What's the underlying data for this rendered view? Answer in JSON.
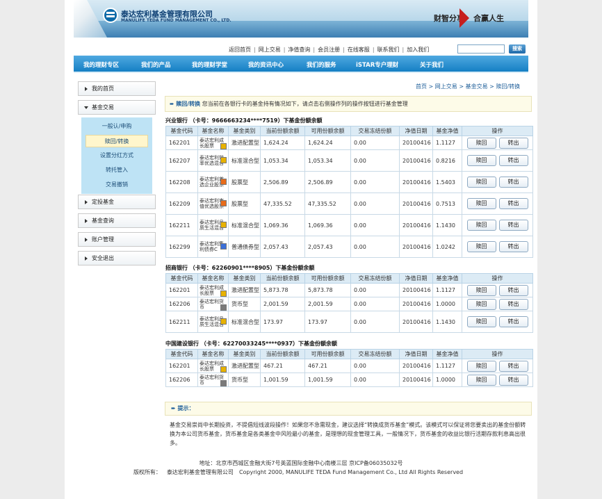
{
  "header": {
    "brand_cn": "泰达宏利基金管理有限公司",
    "brand_en": "MANULIFE TEDA FUND MANAGEMENT CO., LTD.",
    "slogan_left": "财智分享",
    "slogan_right": "合赢人生",
    "top_links": [
      "返回首页",
      "网上交易",
      "净值查询",
      "会员注册",
      "在线客服",
      "联系我们",
      "加入我们"
    ],
    "search_button": "搜索",
    "search_placeholder": ""
  },
  "nav": [
    "我的理财专区",
    "我们的产品",
    "我的理财学堂",
    "我的资讯中心",
    "我们的服务",
    "iSTAR专户理财",
    "关于我们"
  ],
  "sidebar": {
    "items": [
      "我的首页",
      "基金交易",
      "定投基金",
      "基金查询",
      "账户管理",
      "安全退出"
    ],
    "submenu": [
      "一般认/申购",
      "赎回/转换",
      "设置分红方式",
      "转托管入",
      "交易撤销"
    ],
    "active_sub": 1
  },
  "breadcrumb": [
    "首页",
    "网上交易",
    "基金交易",
    "赎回/转换"
  ],
  "info": {
    "label": "赎回/转换",
    "text": "您当前在各银行卡的基金持有情况如下，请点击右侧操作列的操作按钮进行基金管理"
  },
  "columns": [
    "基金代码",
    "基金名称",
    "基金类别",
    "当前份额余额",
    "可用份额余额",
    "交易冻结份额",
    "净值日期",
    "基金净值",
    "操作"
  ],
  "buttons": {
    "redeem": "赎回",
    "transfer": "转出"
  },
  "risk_colors": {
    "yellow": "#e8b200",
    "orange": "#e86b1a",
    "gray": "#7a7a7a",
    "blue": "#3b6fd9"
  },
  "banks": [
    {
      "title": "兴业银行 （卡号：9666663234****7519）下基金份额余额",
      "rows": [
        {
          "code": "162201",
          "name": "泰达宏利成长股票",
          "risk": "yellow",
          "type": "激进配置型",
          "balance": "1,624.24",
          "available": "1,624.24",
          "frozen": "0.00",
          "date": "20100416",
          "nav": "1.1127"
        },
        {
          "code": "162207",
          "name": "泰达宏利效率优选混合",
          "risk": "yellow",
          "type": "标准混合型",
          "balance": "1,053.34",
          "available": "1,053.34",
          "frozen": "0.00",
          "date": "20100416",
          "nav": "0.8216"
        },
        {
          "code": "162208",
          "name": "泰达宏利首选企业股票",
          "risk": "orange",
          "type": "股票型",
          "balance": "2,506.89",
          "available": "2,506.89",
          "frozen": "0.00",
          "date": "20100416",
          "nav": "1.5403"
        },
        {
          "code": "162209",
          "name": "泰达宏利市值优选股票",
          "risk": "orange",
          "type": "股票型",
          "balance": "47,335.52",
          "available": "47,335.52",
          "frozen": "0.00",
          "date": "20100416",
          "nav": "0.7513"
        },
        {
          "code": "162211",
          "name": "泰达宏利品质生活混合",
          "risk": "yellow",
          "type": "标准混合型",
          "balance": "1,069.36",
          "available": "1,069.36",
          "frozen": "0.00",
          "date": "20100416",
          "nav": "1.1430"
        },
        {
          "code": "162299",
          "name": "泰达宏利集利债券C",
          "risk": "blue",
          "type": "普通债券型",
          "balance": "2,057.43",
          "available": "2,057.43",
          "frozen": "0.00",
          "date": "20100416",
          "nav": "1.0242"
        }
      ]
    },
    {
      "title": "招商银行 （卡号：62260901****8905）下基金份额余额",
      "rows": [
        {
          "code": "162201",
          "name": "泰达宏利成长股票",
          "risk": "yellow",
          "type": "激进配置型",
          "balance": "5,873.78",
          "available": "5,873.78",
          "frozen": "0.00",
          "date": "20100416",
          "nav": "1.1127"
        },
        {
          "code": "162206",
          "name": "泰达宏利货币",
          "risk": "gray",
          "type": "货币型",
          "balance": "2,001.59",
          "available": "2,001.59",
          "frozen": "0.00",
          "date": "20100416",
          "nav": "1.0000"
        },
        {
          "code": "162211",
          "name": "泰达宏利品质生活混合",
          "risk": "yellow",
          "type": "标准混合型",
          "balance": "173.97",
          "available": "173.97",
          "frozen": "0.00",
          "date": "20100416",
          "nav": "1.1430"
        }
      ]
    },
    {
      "title": "中国建设银行 （卡号：62270033245****0937）下基金份额余额",
      "rows": [
        {
          "code": "162201",
          "name": "泰达宏利成长股票",
          "risk": "yellow",
          "type": "激进配置型",
          "balance": "467.21",
          "available": "467.21",
          "frozen": "0.00",
          "date": "20100416",
          "nav": "1.1127"
        },
        {
          "code": "162206",
          "name": "泰达宏利货币",
          "risk": "gray",
          "type": "货币型",
          "balance": "1,001.59",
          "available": "1,001.59",
          "frozen": "0.00",
          "date": "20100416",
          "nav": "1.0000"
        }
      ]
    }
  ],
  "tip": {
    "title": "提示：",
    "text": "基金交易崇尚中长期投资，不提倡短线波段操作！如果您不急需现金，建议选择“转换成货币基金”模式。该模式可以保证将您要卖出的基金份额转换为本公司货币基金，货币基金是各类基金中风险最小的基金，是理想的现金管理工具，一般情况下，货币基金的收益比银行活期存款利息高出很多。"
  },
  "footer": {
    "address": "地址：北京市西城区金融大街7号英蓝国际金融中心南楼三层 京ICP备06035032号",
    "rights_label": "版权所有：",
    "company": "泰达宏利基金管理有限公司",
    "copyright": "Copyright 2000, MANULIFE TEDA Fund Management Co., Ltd All Rights Reserved"
  }
}
